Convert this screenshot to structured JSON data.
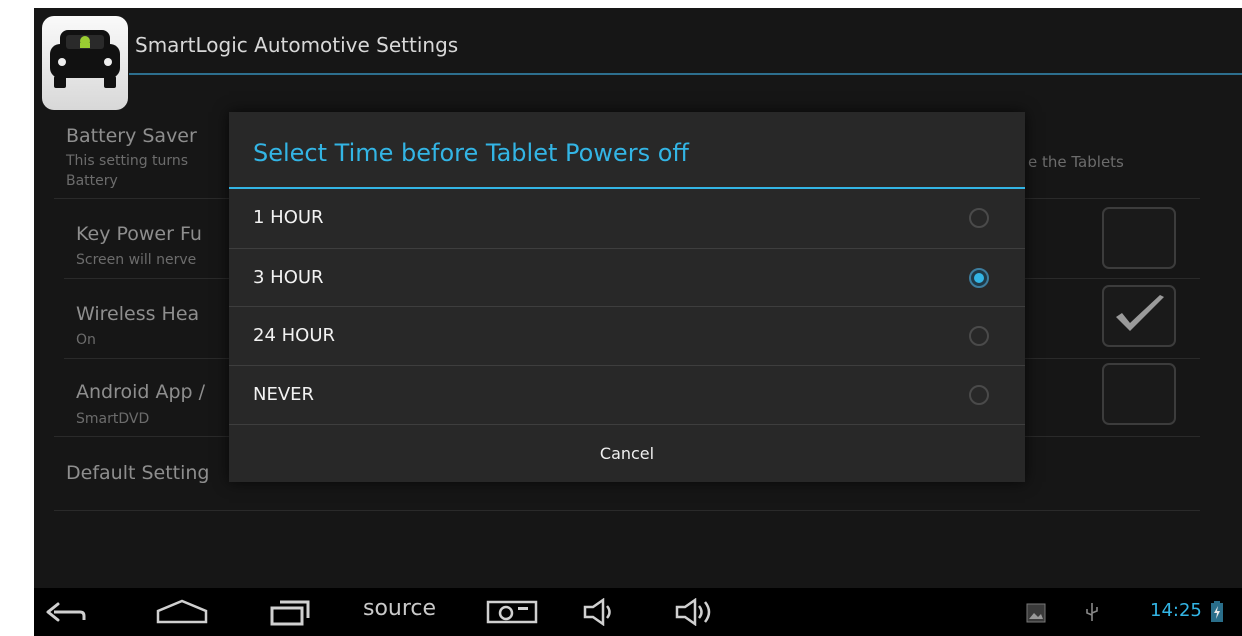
{
  "app": {
    "title": "SmartLogic Automotive Settings"
  },
  "settings": {
    "battery_saver": {
      "title": "Battery Saver",
      "summary_left": "This setting turns",
      "summary_right": "e the Tablets",
      "summary_line2": "Battery"
    },
    "key_power": {
      "title": "Key Power Fu",
      "summary": "Screen will nerve",
      "checked": false
    },
    "wireless": {
      "title": "Wireless Hea",
      "summary": "On",
      "checked": true
    },
    "android_app": {
      "title": "Android App /",
      "summary": "SmartDVD",
      "checked": false
    },
    "default_settings": {
      "title": "Default Setting"
    }
  },
  "dialog": {
    "title": "Select Time before Tablet Powers off",
    "options": [
      {
        "label": "1 HOUR",
        "selected": false
      },
      {
        "label": "3 HOUR",
        "selected": true
      },
      {
        "label": "24 HOUR",
        "selected": false
      },
      {
        "label": "NEVER",
        "selected": false
      }
    ],
    "cancel_label": "Cancel"
  },
  "systembar": {
    "source_label": "source",
    "clock": "14:25",
    "icons": [
      "back-icon",
      "home-icon",
      "recent-apps-icon",
      "screenshot-icon",
      "volume-down-icon",
      "volume-up-icon",
      "gallery-icon",
      "usb-icon",
      "battery-charging-icon"
    ]
  },
  "colors": {
    "accent": "#33b5e5",
    "background": "#161616",
    "dialog": "#282828"
  }
}
